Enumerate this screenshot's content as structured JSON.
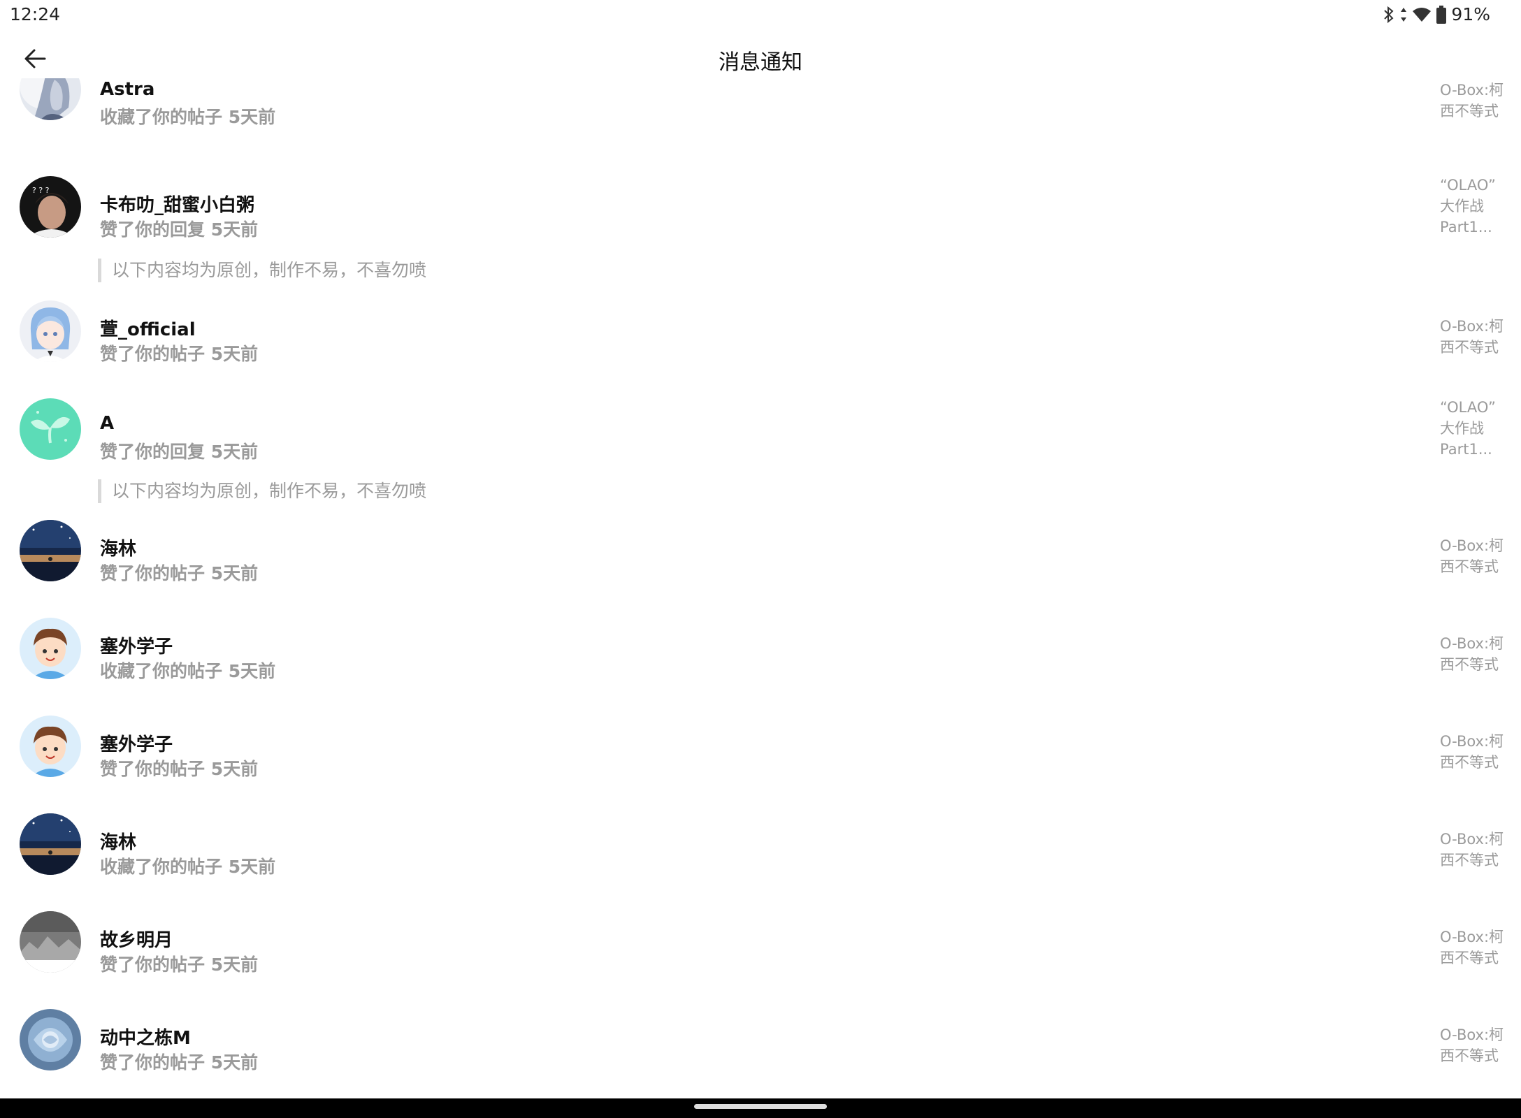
{
  "status_bar": {
    "time": "12:24",
    "battery": "91%"
  },
  "header": {
    "title": "消息通知"
  },
  "notifications": [
    {
      "name": "Astra",
      "action": "收藏了你的帖子 5天前",
      "post_lines": [
        "O-Box:柯",
        "西不等式"
      ],
      "avatar": "avatar-astra"
    },
    {
      "name": "卡布叻_甜蜜小白粥",
      "action": "赞了你的回复 5天前",
      "quote": "以下内容均为原创，制作不易，不喜勿喷",
      "post_lines": [
        "“OLAO”",
        "大作战",
        "Part1..."
      ],
      "avatar": "avatar-kabule"
    },
    {
      "name": "萱_official",
      "action": "赞了你的帖子 5天前",
      "post_lines": [
        "O-Box:柯",
        "西不等式"
      ],
      "avatar": "avatar-xuan"
    },
    {
      "name": "A",
      "action": "赞了你的回复 5天前",
      "quote": "以下内容均为原创，制作不易，不喜勿喷",
      "post_lines": [
        "“OLAO”",
        "大作战",
        "Part1..."
      ],
      "avatar": "avatar-sprout"
    },
    {
      "name": "海林",
      "action": "赞了你的帖子 5天前",
      "post_lines": [
        "O-Box:柯",
        "西不等式"
      ],
      "avatar": "avatar-night-sky"
    },
    {
      "name": "塞外学子",
      "action": "收藏了你的帖子 5天前",
      "post_lines": [
        "O-Box:柯",
        "西不等式"
      ],
      "avatar": "avatar-cartoon-boy"
    },
    {
      "name": "塞外学子",
      "action": "赞了你的帖子 5天前",
      "post_lines": [
        "O-Box:柯",
        "西不等式"
      ],
      "avatar": "avatar-cartoon-boy"
    },
    {
      "name": "海林",
      "action": "收藏了你的帖子 5天前",
      "post_lines": [
        "O-Box:柯",
        "西不等式"
      ],
      "avatar": "avatar-night-sky"
    },
    {
      "name": "故乡明月",
      "action": "赞了你的帖子 5天前",
      "post_lines": [
        "O-Box:柯",
        "西不等式"
      ],
      "avatar": "avatar-gray-sketch"
    },
    {
      "name": "动中之栋M",
      "action": "赞了你的帖子 5天前",
      "post_lines": [
        "O-Box:柯",
        "西不等式"
      ],
      "avatar": "avatar-blue-rose"
    }
  ]
}
